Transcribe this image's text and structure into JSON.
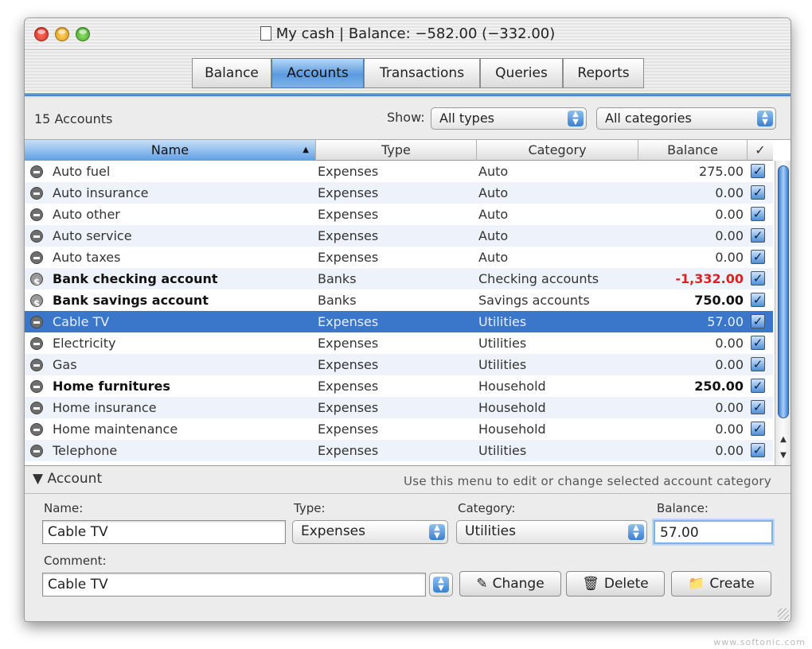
{
  "window": {
    "title": "My cash | Balance: −582.00 (−332.00)"
  },
  "tabs": [
    {
      "label": "Balance"
    },
    {
      "label": "Accounts"
    },
    {
      "label": "Transactions"
    },
    {
      "label": "Queries"
    },
    {
      "label": "Reports"
    }
  ],
  "toolbar": {
    "count_label": "15 Accounts",
    "show_label": "Show:",
    "type_filter": "All types",
    "category_filter": "All categories"
  },
  "table": {
    "columns": [
      "Name",
      "Type",
      "Category",
      "Balance",
      "✓"
    ],
    "rows": [
      {
        "name": "Auto fuel",
        "type": "Expenses",
        "category": "Auto",
        "balance": "275.00",
        "icon": "minus-circle-icon"
      },
      {
        "name": "Auto insurance",
        "type": "Expenses",
        "category": "Auto",
        "balance": "0.00",
        "icon": "minus-circle-icon"
      },
      {
        "name": "Auto other",
        "type": "Expenses",
        "category": "Auto",
        "balance": "0.00",
        "icon": "minus-circle-icon"
      },
      {
        "name": "Auto service",
        "type": "Expenses",
        "category": "Auto",
        "balance": "0.00",
        "icon": "minus-circle-icon"
      },
      {
        "name": "Auto taxes",
        "type": "Expenses",
        "category": "Auto",
        "balance": "0.00",
        "icon": "minus-circle-icon"
      },
      {
        "name": "Bank checking account",
        "type": "Banks",
        "category": "Checking accounts",
        "balance": "-1,332.00",
        "icon": "dollar-circle-icon"
      },
      {
        "name": "Bank savings account",
        "type": "Banks",
        "category": "Savings accounts",
        "balance": "750.00",
        "icon": "dollar-circle-icon"
      },
      {
        "name": "Cable TV",
        "type": "Expenses",
        "category": "Utilities",
        "balance": "57.00",
        "icon": "minus-circle-icon"
      },
      {
        "name": "Electricity",
        "type": "Expenses",
        "category": "Utilities",
        "balance": "0.00",
        "icon": "minus-circle-icon"
      },
      {
        "name": "Gas",
        "type": "Expenses",
        "category": "Utilities",
        "balance": "0.00",
        "icon": "minus-circle-icon"
      },
      {
        "name": "Home furnitures",
        "type": "Expenses",
        "category": "Household",
        "balance": "250.00",
        "icon": "minus-circle-icon"
      },
      {
        "name": "Home insurance",
        "type": "Expenses",
        "category": "Household",
        "balance": "0.00",
        "icon": "minus-circle-icon"
      },
      {
        "name": "Home maintenance",
        "type": "Expenses",
        "category": "Household",
        "balance": "0.00",
        "icon": "minus-circle-icon"
      },
      {
        "name": "Telephone",
        "type": "Expenses",
        "category": "Utilities",
        "balance": "0.00",
        "icon": "minus-circle-icon"
      }
    ]
  },
  "account_panel": {
    "heading": "Account",
    "hint": "Use this menu to edit or change selected account category",
    "name_label": "Name:",
    "name_value": "Cable TV",
    "type_label": "Type:",
    "type_value": "Expenses",
    "category_label": "Category:",
    "category_value": "Utilities",
    "balance_label": "Balance:",
    "balance_value": "57.00",
    "comment_label": "Comment:",
    "comment_value": "Cable TV",
    "change_label": "Change",
    "delete_label": "Delete",
    "create_label": "Create"
  },
  "colors": {
    "selection": "#3a76c9",
    "negative": "#e02020",
    "accent": "#4a8ad8"
  },
  "watermark": "www.softonic.com"
}
